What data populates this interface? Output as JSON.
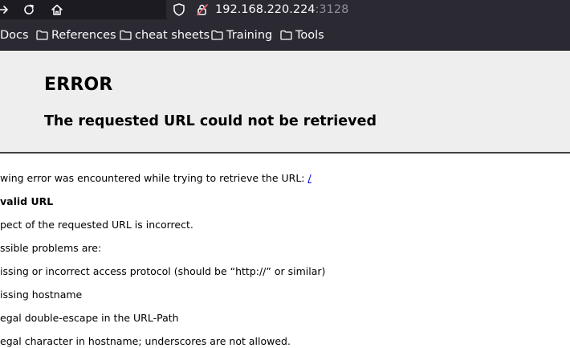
{
  "toolbar": {
    "forward_icon": "arrow-right-icon",
    "reload_icon": "reload-icon",
    "home_icon": "home-icon",
    "url_host": "192.168.220.224",
    "url_port": ":3128"
  },
  "bookmarks": [
    {
      "label": "Docs",
      "icon": "folder-icon"
    },
    {
      "label": "References",
      "icon": "folder-icon"
    },
    {
      "label": "cheat sheets",
      "icon": "folder-icon"
    },
    {
      "label": "Training",
      "icon": "folder-icon"
    },
    {
      "label": "Tools",
      "icon": "folder-icon"
    }
  ],
  "page": {
    "title": "ERROR",
    "subtitle": "The requested URL could not be retrieved",
    "intro_text": "wing error was encountered while trying to retrieve the URL: ",
    "intro_link": "/",
    "error_name": "valid URL",
    "lines": [
      "pect of the requested URL is incorrect.",
      "ssible problems are:",
      "issing or incorrect access protocol (should be “http://” or similar)",
      "issing hostname",
      "egal double-escape in the URL-Path",
      "egal character in hostname; underscores are not allowed."
    ]
  },
  "colors": {
    "toolbar_bg": "#1c1b22",
    "bar_bg": "#2b2a33",
    "header_bg": "#eeeeee",
    "link": "#0000ee"
  }
}
